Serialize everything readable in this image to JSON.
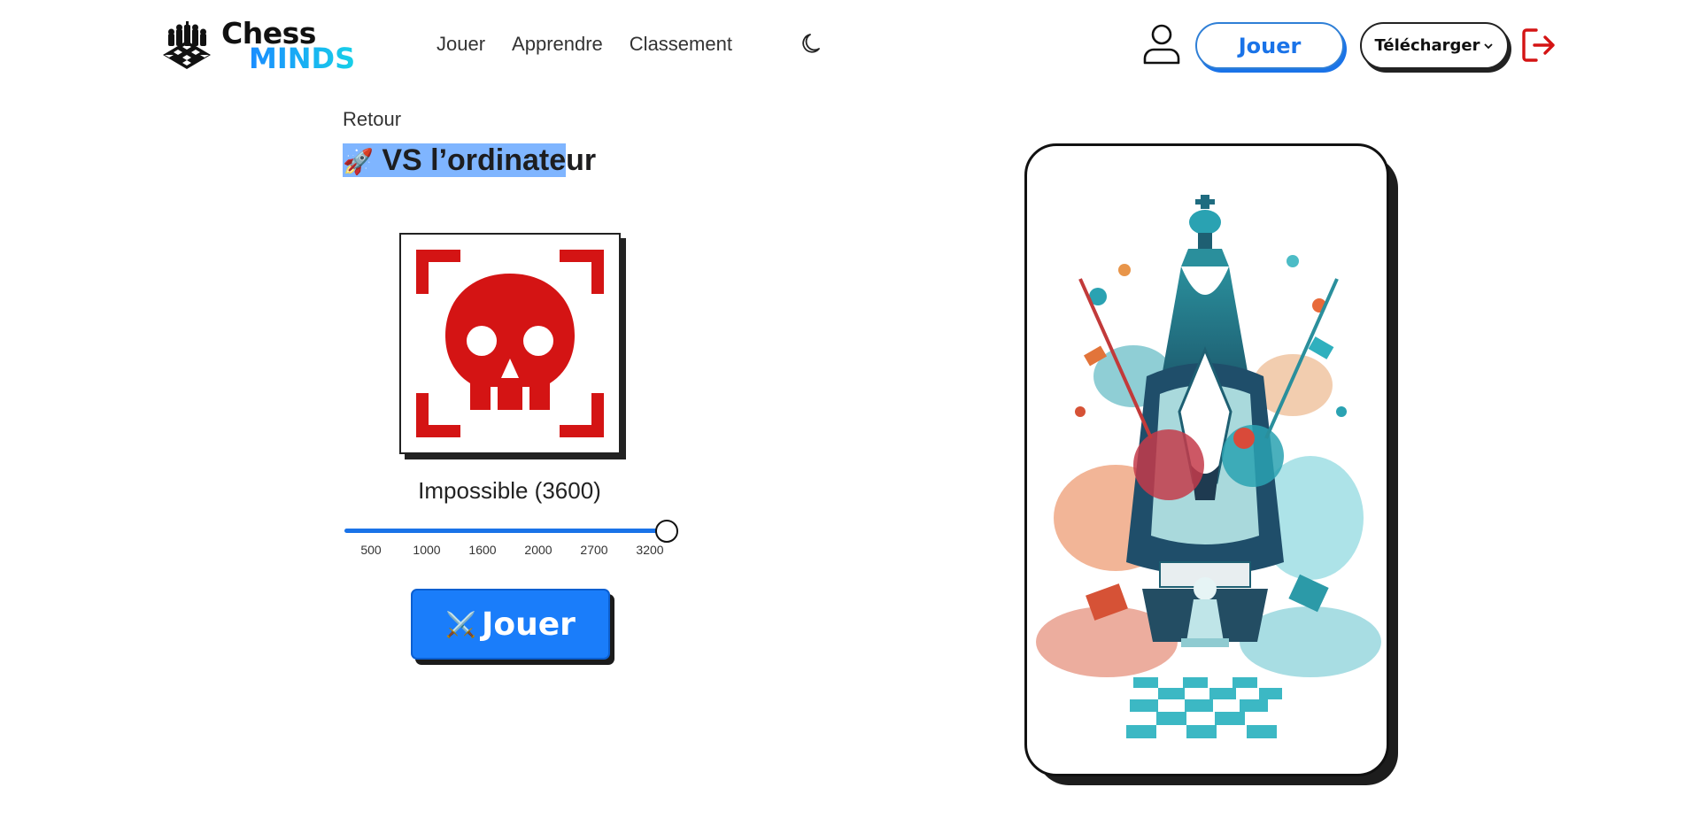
{
  "header": {
    "logo": {
      "line1": "Chess",
      "line2": "MINDS"
    },
    "nav": [
      {
        "label": "Jouer"
      },
      {
        "label": "Apprendre"
      },
      {
        "label": "Classement"
      }
    ],
    "play_button": "Jouer",
    "download_button": "Télécharger"
  },
  "main": {
    "back_link": "Retour",
    "title_emoji": "🚀",
    "title_selected": "VS l’ordinate",
    "title_rest": "ur",
    "difficulty": {
      "label": "Impossible (3600)",
      "icon": "skull-icon",
      "slider": {
        "value": 3600,
        "ticks": [
          "500",
          "1000",
          "1600",
          "2000",
          "2700",
          "3200"
        ]
      }
    },
    "play_button": {
      "icon": "⚔️",
      "label": "Jouer"
    }
  },
  "colors": {
    "accent": "#1a7dfa",
    "danger": "#d41414",
    "logo_gradient": [
      "#1a8cff",
      "#17d0e8"
    ]
  }
}
